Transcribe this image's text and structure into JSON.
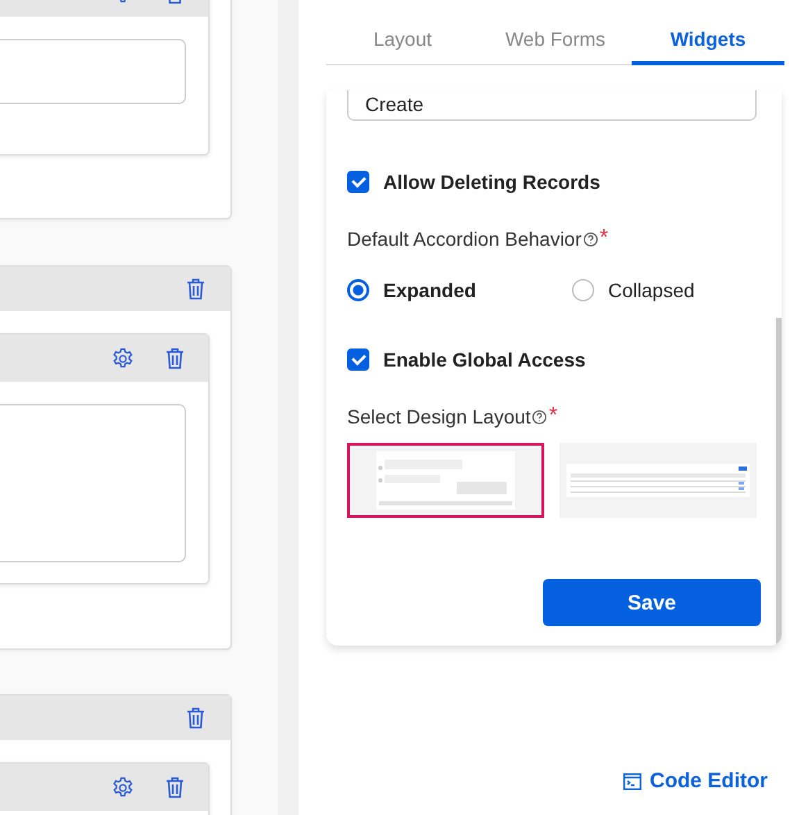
{
  "canvas": {
    "sections": [
      {
        "kind": "bottom"
      },
      {
        "kind": "whole"
      },
      {
        "kind": "top"
      }
    ]
  },
  "tabs": [
    {
      "label": "Layout",
      "selected": false
    },
    {
      "label": "Web Forms",
      "selected": false
    },
    {
      "label": "Widgets",
      "selected": true
    }
  ],
  "form": {
    "action_field": {
      "value": "Create"
    },
    "allow_deleting": {
      "label": "Allow Deleting Records",
      "checked": true
    },
    "accordion": {
      "label": "Default Accordion Behavior",
      "required_mark": "*",
      "options": [
        {
          "label": "Expanded",
          "selected": true
        },
        {
          "label": "Collapsed",
          "selected": false
        }
      ]
    },
    "global_access": {
      "label": "Enable Global Access",
      "checked": true
    },
    "design_layout": {
      "label": "Select Design Layout",
      "required_mark": "*",
      "options": [
        {
          "kind": "chat",
          "selected": true
        },
        {
          "kind": "table",
          "selected": false
        }
      ]
    },
    "save_button": "Save"
  },
  "code_editor": "Code Editor"
}
